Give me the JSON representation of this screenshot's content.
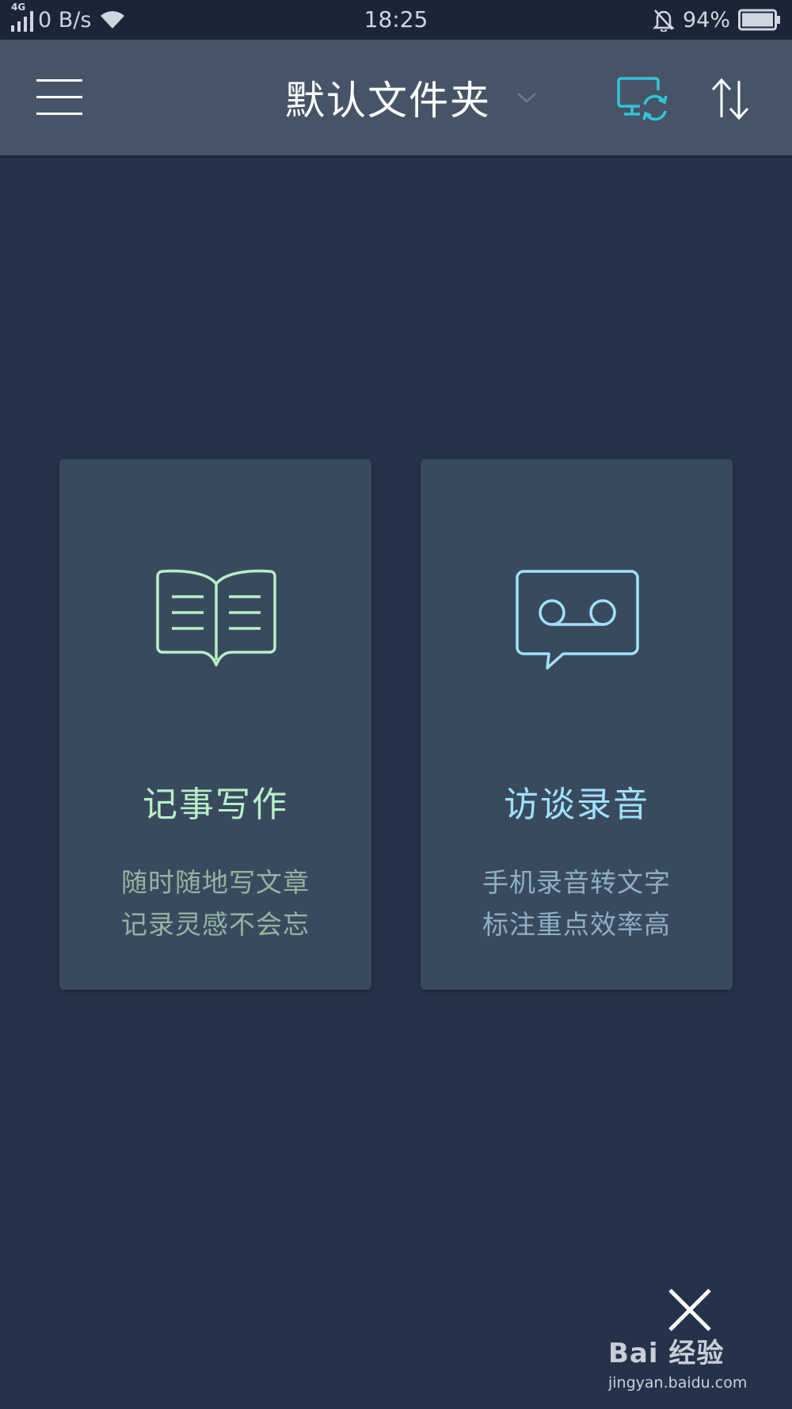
{
  "status_bar": {
    "network_type": "4G",
    "speed": "0 B/s",
    "time": "18:25",
    "battery_percent": "94%",
    "icons": [
      "signal-icon",
      "wifi-icon",
      "mute-bell-icon",
      "battery-icon"
    ]
  },
  "app_bar": {
    "title": "默认文件夹",
    "icons": [
      "menu-icon",
      "chevron-down-icon",
      "sync-icon",
      "sort-icon"
    ],
    "accent_color": "#35c3d6"
  },
  "cards": [
    {
      "title": "记事写作",
      "desc_line1": "随时随地写文章",
      "desc_line2": "记录灵感不会忘",
      "icon": "book-icon",
      "color": "#b6f0c7"
    },
    {
      "title": "访谈录音",
      "desc_line1": "手机录音转文字",
      "desc_line2": "标注重点效率高",
      "icon": "voicemail-icon",
      "color": "#9fe2ff"
    }
  ],
  "close_icon": "close-icon",
  "watermark": {
    "brand": "Bai 经验",
    "url": "jingyan.baidu.com"
  }
}
